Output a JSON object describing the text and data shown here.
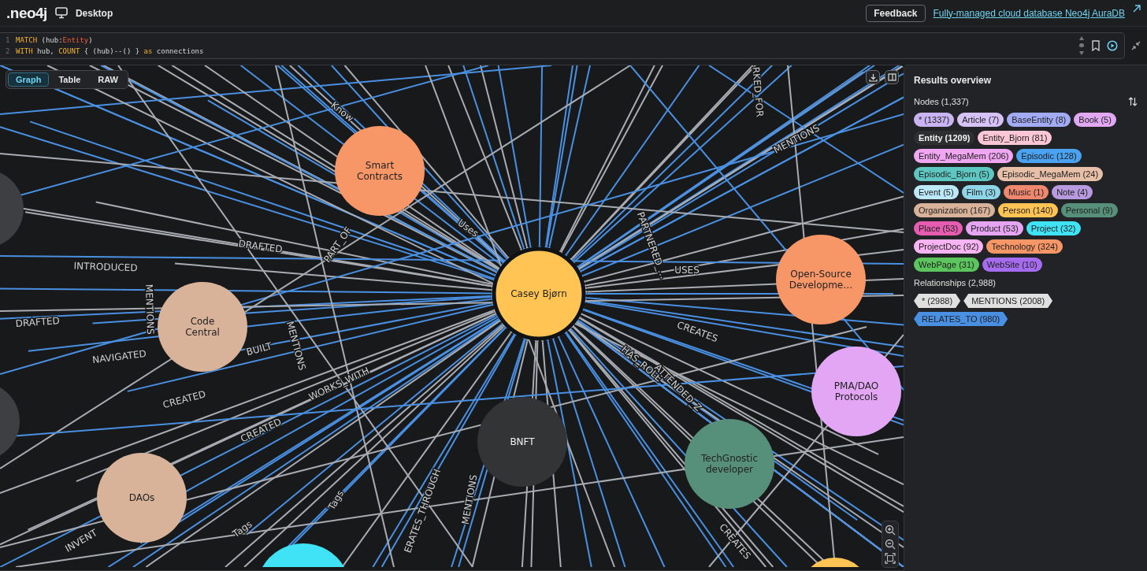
{
  "header": {
    "logo": ".neo4j",
    "product": "Desktop",
    "feedback": "Feedback",
    "promo_link": "Fully-managed cloud database Neo4j AuraDB"
  },
  "editor": {
    "lines": [
      {
        "number": "1",
        "tokens": [
          {
            "text": "MATCH",
            "kind": "keyword"
          },
          {
            "text": " (hub:",
            "kind": "plain"
          },
          {
            "text": "Entity",
            "kind": "label"
          },
          {
            "text": ")",
            "kind": "plain"
          }
        ]
      },
      {
        "number": "2",
        "tokens": [
          {
            "text": "WITH",
            "kind": "keyword"
          },
          {
            "text": " hub, ",
            "kind": "plain"
          },
          {
            "text": "COUNT",
            "kind": "keyword"
          },
          {
            "text": " { (hub)--() } ",
            "kind": "plain"
          },
          {
            "text": "as",
            "kind": "keyword"
          },
          {
            "text": " connections",
            "kind": "plain"
          }
        ]
      }
    ]
  },
  "view_tabs": [
    {
      "label": "Graph",
      "selected": true
    },
    {
      "label": "Table",
      "selected": false
    },
    {
      "label": "RAW",
      "selected": false
    }
  ],
  "graph": {
    "nodes": [
      {
        "label": "Smart Contracts",
        "color": "#f79767"
      },
      {
        "label": "Casey Bjørn",
        "color": "#ffc454"
      },
      {
        "label": "Code Central",
        "color": "#d9b399"
      },
      {
        "label": "Open-Source Developme…",
        "color": "#f79767"
      },
      {
        "label": "PMA/DAO Protocols",
        "color": "#e3a6f5"
      },
      {
        "label": "BNFT",
        "color": "#333436"
      },
      {
        "label": "TechGnostic developer",
        "color": "#57907a"
      },
      {
        "label": "DAOs",
        "color": "#d9b399"
      },
      {
        "color": "#40e3f5"
      },
      {
        "color": "#ffc454"
      },
      {
        "color": "#333436"
      },
      {
        "color": "#333436"
      }
    ],
    "edge_labels": [
      {
        "text": "Know"
      },
      {
        "text": "Uses"
      },
      {
        "text": "DRAFTED"
      },
      {
        "text": "PART_OF"
      },
      {
        "text": "INTRODUCED"
      },
      {
        "text": "MENTIONS"
      },
      {
        "text": "DRAFTED"
      },
      {
        "text": "NAVIGATED"
      },
      {
        "text": "BUILT"
      },
      {
        "text": "MENTIONS"
      },
      {
        "text": "CREATED"
      },
      {
        "text": "WORKS_WITH"
      },
      {
        "text": "CREATED"
      },
      {
        "text": "Tags"
      },
      {
        "text": "Tags"
      },
      {
        "text": "INVENT"
      },
      {
        "text": "MENTIONS"
      },
      {
        "text": "ERATES_THROUGH"
      },
      {
        "text": "PARTNERED_…"
      },
      {
        "text": "USES"
      },
      {
        "text": "CREATES"
      },
      {
        "text": "HAS_ROLE"
      },
      {
        "text": "ATTENDED_Z"
      },
      {
        "text": "MENTIONS"
      },
      {
        "text": "RKED_FOR"
      },
      {
        "text": "CREATES"
      }
    ]
  },
  "results": {
    "title": "Results overview",
    "nodes_heading": "Nodes (1,337)",
    "node_labels": [
      {
        "text": "* (1337)",
        "color": "#c9b3f2"
      },
      {
        "text": "Article (7)",
        "color": "#d6c2f7"
      },
      {
        "text": "BaseEntity (8)",
        "color": "#a3abf5"
      },
      {
        "text": "Book (5)",
        "color": "#e2a8f2"
      },
      {
        "text": "Entity (1209)",
        "color": "#2e2f31"
      },
      {
        "text": "Entity_Bjorn (81)",
        "color": "#fbc6d6"
      },
      {
        "text": "Entity_MegaMem (206)",
        "color": "#f0a6f0"
      },
      {
        "text": "Episodic (128)",
        "color": "#4aa2f0"
      },
      {
        "text": "Episodic_Bjorn (5)",
        "color": "#5fc7c2"
      },
      {
        "text": "Episodic_MegaMem (24)",
        "color": "#e8bfa8"
      },
      {
        "text": "Event (5)",
        "color": "#bde8f8"
      },
      {
        "text": "Film (3)",
        "color": "#8ed5e8"
      },
      {
        "text": "Music (1)",
        "color": "#f08870"
      },
      {
        "text": "Note (4)",
        "color": "#b89ae0"
      },
      {
        "text": "Organization (167)",
        "color": "#d9b399"
      },
      {
        "text": "Person (140)",
        "color": "#ffc454"
      },
      {
        "text": "Personal (9)",
        "color": "#57907a"
      },
      {
        "text": "Place (53)",
        "color": "#e65cb0"
      },
      {
        "text": "Product (53)",
        "color": "#e5a5f2"
      },
      {
        "text": "Project (32)",
        "color": "#40e3f5"
      },
      {
        "text": "ProjectDoc (92)",
        "color": "#f7b3f2"
      },
      {
        "text": "Technology (324)",
        "color": "#f79767"
      },
      {
        "text": "WebPage (31)",
        "color": "#5dc55d"
      },
      {
        "text": "WebSite (10)",
        "color": "#a66cf0"
      }
    ],
    "relationships_heading": "Relationships (2,988)",
    "relationship_types": [
      {
        "text": "* (2988)",
        "color": "#e0e0e0"
      },
      {
        "text": "MENTIONS (2008)",
        "color": "#e0e0e0"
      },
      {
        "text": "RELATES_TO (980)",
        "color": "#4a90e2"
      }
    ]
  }
}
